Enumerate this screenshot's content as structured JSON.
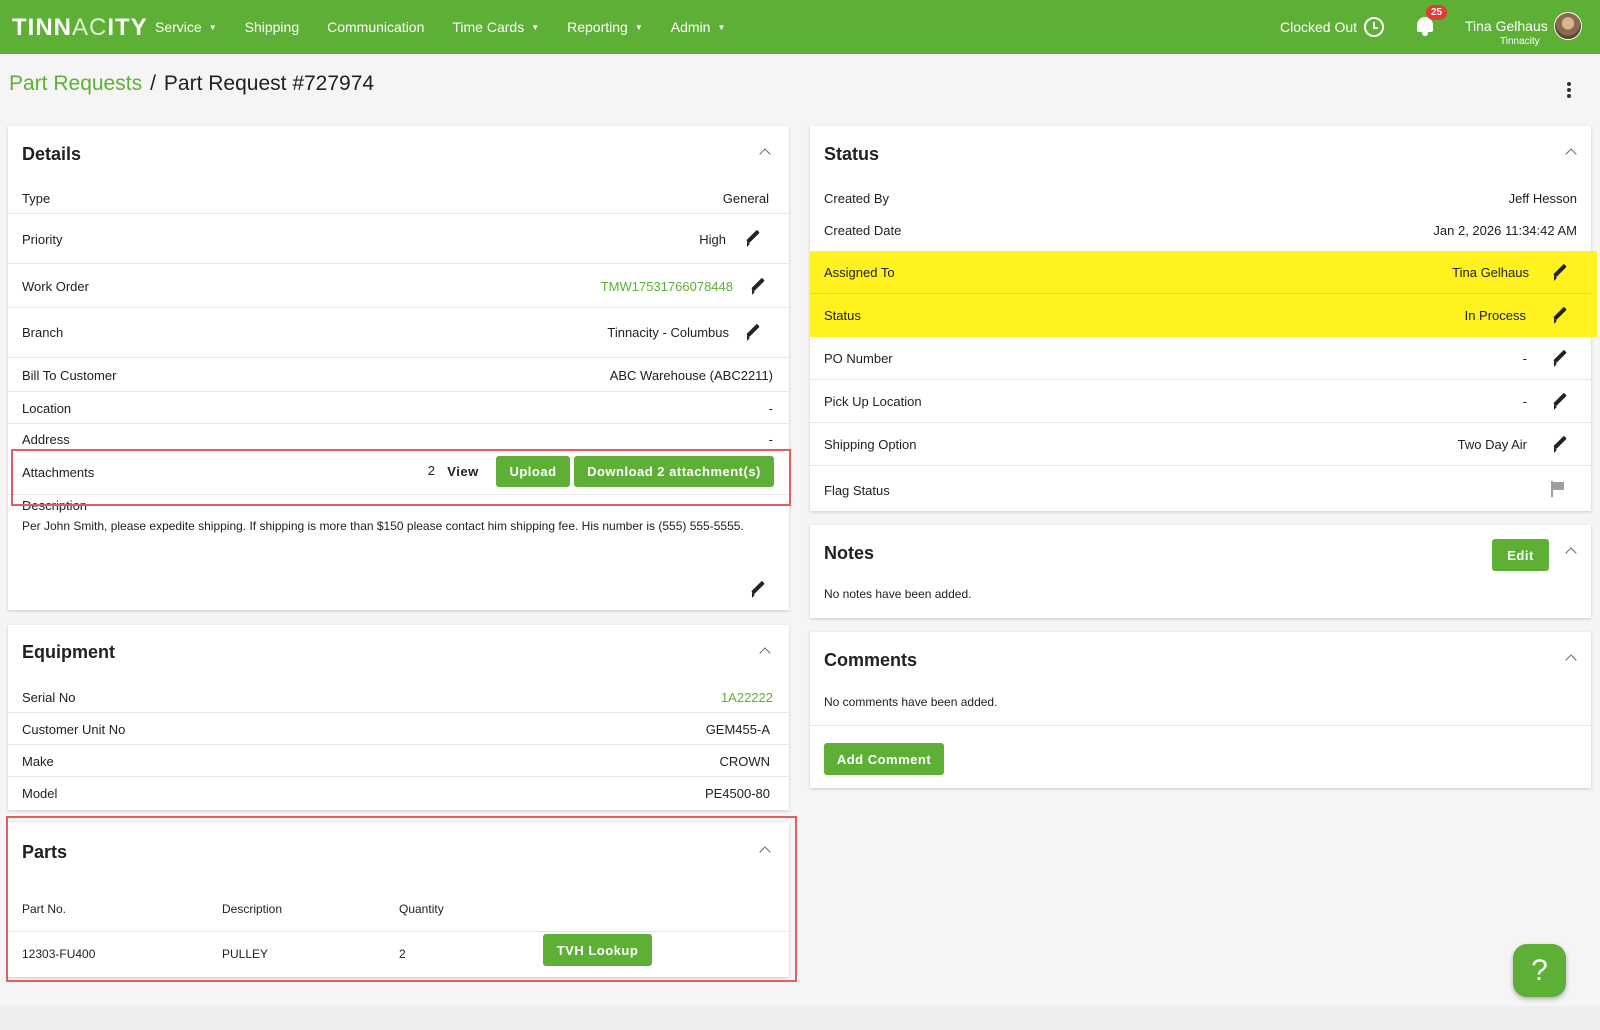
{
  "app": {
    "logo_main": "TINN",
    "logo_thin": "AC",
    "logo_end": "ITY",
    "colors": {
      "brand_green": "#5db035",
      "highlight_yellow": "#fff21e",
      "annotation_red": "#e06060"
    }
  },
  "nav": [
    {
      "label": "Service",
      "dropdown": true
    },
    {
      "label": "Shipping",
      "dropdown": false
    },
    {
      "label": "Communication",
      "dropdown": false
    },
    {
      "label": "Time Cards",
      "dropdown": true
    },
    {
      "label": "Reporting",
      "dropdown": true
    },
    {
      "label": "Admin",
      "dropdown": true
    }
  ],
  "header": {
    "clock_status": "Clocked Out",
    "notification_count": "25",
    "user_name": "Tina Gelhaus",
    "user_org": "Tinnacity"
  },
  "breadcrumb": {
    "parent": "Part Requests",
    "separator": "/",
    "current": "Part Request #727974"
  },
  "details": {
    "title": "Details",
    "type_label": "Type",
    "type_value": "General",
    "priority_label": "Priority",
    "priority_value": "High",
    "work_order_label": "Work Order",
    "work_order_value": "TMW17531766078448",
    "branch_label": "Branch",
    "branch_value": "Tinnacity - Columbus",
    "bill_to_label": "Bill To Customer",
    "bill_to_value": "ABC Warehouse (ABC2211)",
    "location_label": "Location",
    "location_value": "-",
    "address_label": "Address",
    "address_value": "-",
    "attachments_label": "Attachments",
    "attachments_count": "2",
    "view_label": "View",
    "upload_label": "Upload",
    "download_label": "Download 2 attachment(s)",
    "description_label": "Description",
    "description_text": "Per John Smith, please expedite shipping. If shipping is more than $150 please contact him shipping fee.  His number is (555) 555-5555."
  },
  "equipment": {
    "title": "Equipment",
    "serial_label": "Serial No",
    "serial_value": "1A22222",
    "unit_label": "Customer Unit No",
    "unit_value": "GEM455-A",
    "make_label": "Make",
    "make_value": "CROWN",
    "model_label": "Model",
    "model_value": "PE4500-80"
  },
  "parts": {
    "title": "Parts",
    "columns": [
      "Part No.",
      "Description",
      "Quantity"
    ],
    "rows": [
      {
        "part_no": "12303-FU400",
        "description": "PULLEY",
        "quantity": "2",
        "action": "TVH Lookup"
      }
    ]
  },
  "status": {
    "title": "Status",
    "created_by_label": "Created By",
    "created_by_value": "Jeff Hesson",
    "created_date_label": "Created Date",
    "created_date_value": "Jan 2, 2026 11:34:42 AM",
    "assigned_label": "Assigned To",
    "assigned_value": "Tina Gelhaus",
    "status_label": "Status",
    "status_value": "In Process",
    "po_label": "PO Number",
    "po_value": "-",
    "pickup_label": "Pick Up Location",
    "pickup_value": "-",
    "shipping_label": "Shipping Option",
    "shipping_value": "Two Day Air",
    "flag_label": "Flag Status"
  },
  "notes": {
    "title": "Notes",
    "edit_label": "Edit",
    "empty_text": "No notes have been added."
  },
  "comments": {
    "title": "Comments",
    "empty_text": "No comments have been added.",
    "add_label": "Add Comment"
  },
  "help": {
    "label": "?"
  }
}
